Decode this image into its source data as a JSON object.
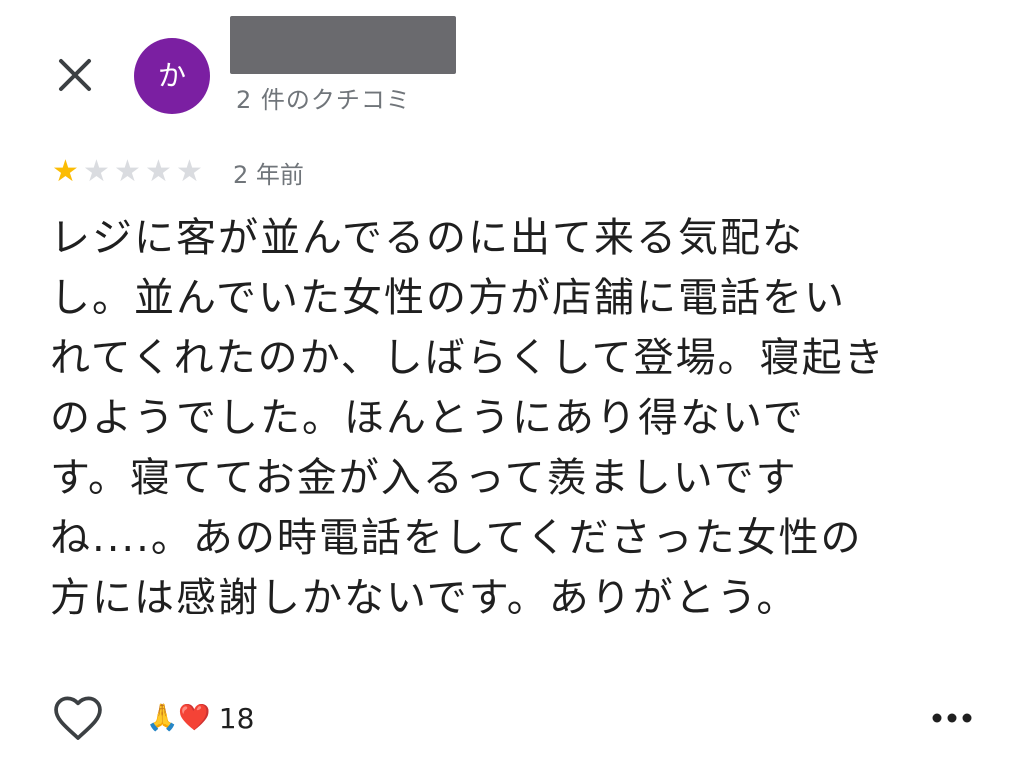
{
  "header": {
    "avatar_initial": "か",
    "avatar_color": "#7b1fa2",
    "reviewer_name": "",
    "review_count": "2 件のクチコミ",
    "close_icon": "close-icon"
  },
  "review": {
    "rating": 1,
    "max_rating": 5,
    "date": "2 年前",
    "star_color": "#fbbc04",
    "text": "レジに客が並んでるのに出て来る気配な\nし。並んでいた女性の方が店舗に電話をい\nれてくれたのか、しばらくして登場。寝起き\nのようでした。ほんとうにあり得ないで\nす。寝ててお金が入るって羨ましいです\nね....。あの時電話をしてくださった女性の\n方には感謝しかないです。ありがとう。"
  },
  "footer": {
    "like_icon": "heart-outline-icon",
    "reaction_emojis": "🙏❤️",
    "reaction_count": "18",
    "more_icon": "more-horizontal-icon"
  }
}
